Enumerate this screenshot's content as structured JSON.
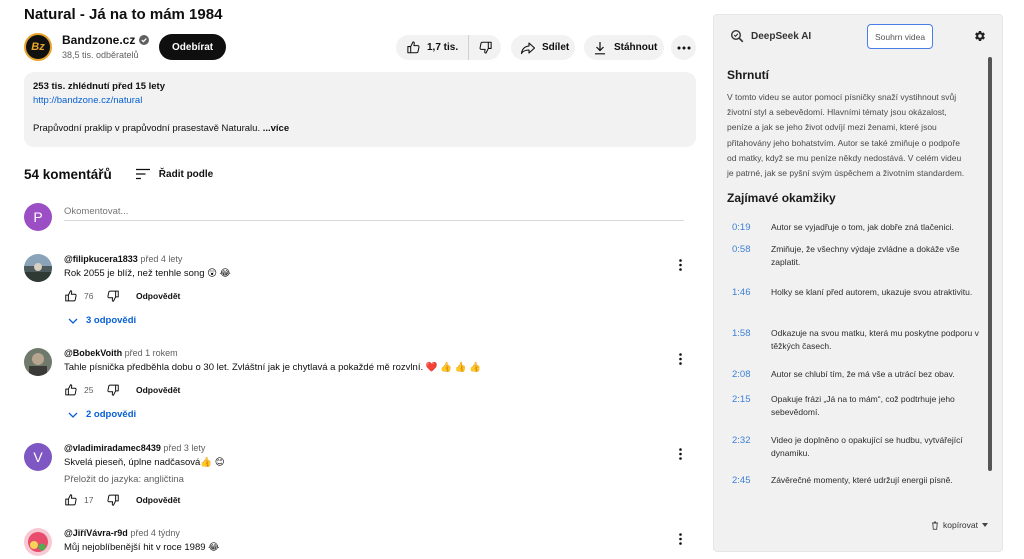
{
  "video": {
    "title": "Natural - Já na to mám 1984",
    "channel": {
      "name": "Bandzone.cz",
      "subscribers": "38,5 tis. odběratelů",
      "avatar_text": "Bz",
      "subscribe_label": "Odebírat"
    },
    "actions": {
      "likes": "1,7 tis.",
      "share": "Sdílet",
      "download": "Stáhnout"
    },
    "description": {
      "stats": "253 tis. zhlédnutí  před 15 lety",
      "link": "http://bandzone.cz/natural",
      "text": "Prapůvodní praklip v prapůvodní prasestavě Naturalu.",
      "more": "...více"
    }
  },
  "comments_section": {
    "count_label": "54 komentářů",
    "sort_label": "Řadit podle",
    "my_avatar_letter": "P",
    "input_placeholder": "Okomentovat...",
    "reply_label": "Odpovědět",
    "comments": [
      {
        "author": "@filipkucera1833",
        "time": "před 4 lety",
        "text": "Rok 2055 je blíž, než tenhle song 😲 😂",
        "likes": "76",
        "replies": "3 odpovědi"
      },
      {
        "author": "@BobekVoith",
        "time": "před 1 rokem",
        "text": "Tahle písnička předběhla dobu o 30 let.  Zvláštní jak je chytlavá a pokaždé mě rozvlní. ❤️ 👍 👍 👍",
        "likes": "25",
        "replies": "2 odpovědi"
      },
      {
        "author": "@vladimiradamec8439",
        "time": "před 3 lety",
        "avatar_letter": "V",
        "text": "Skvelá pieseň, úplne nadčasová👍 😊",
        "translate": "Přeložit do jazyka: angličtina",
        "likes": "17"
      },
      {
        "author": "@JiříVávra-r9d",
        "time": "před 4 týdny",
        "text": "Můj nejoblíbenější hit v roce 1989 😂"
      }
    ]
  },
  "ai_panel": {
    "brand": "DeepSeek AI",
    "summary_button": "Souhrn videa",
    "summary_title": "Shrnutí",
    "summary_text": "V tomto videu se autor pomocí písničky snaží vystihnout svůj životní styl a sebevědomí. Hlavními tématy jsou okázalost, peníze a jak se jeho život odvíjí mezi ženami, které jsou přitahovány jeho bohatstvím. Autor se také zmiňuje o podpoře od matky, když se mu peníze někdy nedostává. V celém videu je patrné, jak se pyšní svým úspěchem a životním standardem.",
    "moments_title": "Zajímavé okamžiky",
    "moments": [
      {
        "time": "0:19",
        "text": "Autor se vyjadřuje o tom, jak dobře zná tlačenici."
      },
      {
        "time": "0:58",
        "text": "Zmiňuje, že všechny výdaje zvládne a dokáže vše zaplatit."
      },
      {
        "time": "1:46",
        "text": "Holky se klaní před autorem, ukazuje svou atraktivitu."
      },
      {
        "time": "1:58",
        "text": "Odkazuje na svou matku, která mu poskytne podporu v těžkých časech."
      },
      {
        "time": "2:08",
        "text": "Autor se chlubí tím, že má vše a utrácí bez obav."
      },
      {
        "time": "2:15",
        "text": "Opakuje frázi „Já na to mám“, což podtrhuje jeho sebevědomí."
      },
      {
        "time": "2:32",
        "text": "Video je doplněno o opakující se hudbu, vytvářející dynamiku."
      },
      {
        "time": "2:45",
        "text": "Závěrečné momenty, které udržují energii písně."
      }
    ],
    "copy_label": "kopírovat"
  }
}
